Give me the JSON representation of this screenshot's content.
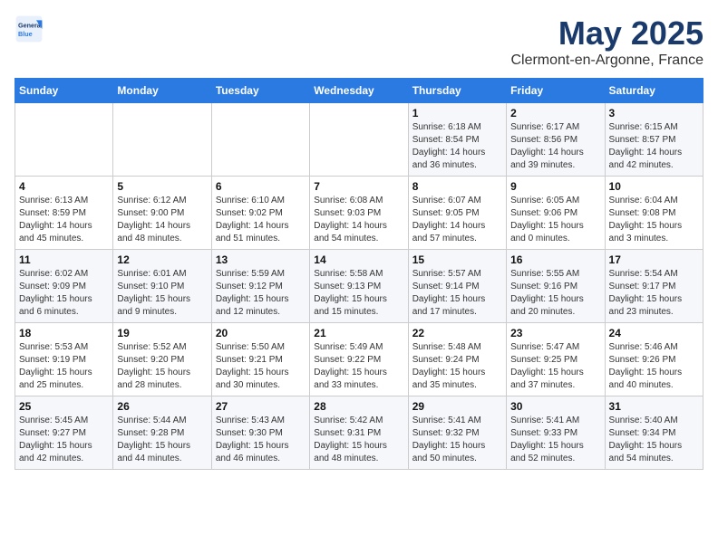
{
  "header": {
    "logo_text_general": "General",
    "logo_text_blue": "Blue",
    "title": "May 2025",
    "subtitle": "Clermont-en-Argonne, France"
  },
  "days_of_week": [
    "Sunday",
    "Monday",
    "Tuesday",
    "Wednesday",
    "Thursday",
    "Friday",
    "Saturday"
  ],
  "weeks": [
    [
      {
        "day": "",
        "info": ""
      },
      {
        "day": "",
        "info": ""
      },
      {
        "day": "",
        "info": ""
      },
      {
        "day": "",
        "info": ""
      },
      {
        "day": "1",
        "info": "Sunrise: 6:18 AM\nSunset: 8:54 PM\nDaylight: 14 hours\nand 36 minutes."
      },
      {
        "day": "2",
        "info": "Sunrise: 6:17 AM\nSunset: 8:56 PM\nDaylight: 14 hours\nand 39 minutes."
      },
      {
        "day": "3",
        "info": "Sunrise: 6:15 AM\nSunset: 8:57 PM\nDaylight: 14 hours\nand 42 minutes."
      }
    ],
    [
      {
        "day": "4",
        "info": "Sunrise: 6:13 AM\nSunset: 8:59 PM\nDaylight: 14 hours\nand 45 minutes."
      },
      {
        "day": "5",
        "info": "Sunrise: 6:12 AM\nSunset: 9:00 PM\nDaylight: 14 hours\nand 48 minutes."
      },
      {
        "day": "6",
        "info": "Sunrise: 6:10 AM\nSunset: 9:02 PM\nDaylight: 14 hours\nand 51 minutes."
      },
      {
        "day": "7",
        "info": "Sunrise: 6:08 AM\nSunset: 9:03 PM\nDaylight: 14 hours\nand 54 minutes."
      },
      {
        "day": "8",
        "info": "Sunrise: 6:07 AM\nSunset: 9:05 PM\nDaylight: 14 hours\nand 57 minutes."
      },
      {
        "day": "9",
        "info": "Sunrise: 6:05 AM\nSunset: 9:06 PM\nDaylight: 15 hours\nand 0 minutes."
      },
      {
        "day": "10",
        "info": "Sunrise: 6:04 AM\nSunset: 9:08 PM\nDaylight: 15 hours\nand 3 minutes."
      }
    ],
    [
      {
        "day": "11",
        "info": "Sunrise: 6:02 AM\nSunset: 9:09 PM\nDaylight: 15 hours\nand 6 minutes."
      },
      {
        "day": "12",
        "info": "Sunrise: 6:01 AM\nSunset: 9:10 PM\nDaylight: 15 hours\nand 9 minutes."
      },
      {
        "day": "13",
        "info": "Sunrise: 5:59 AM\nSunset: 9:12 PM\nDaylight: 15 hours\nand 12 minutes."
      },
      {
        "day": "14",
        "info": "Sunrise: 5:58 AM\nSunset: 9:13 PM\nDaylight: 15 hours\nand 15 minutes."
      },
      {
        "day": "15",
        "info": "Sunrise: 5:57 AM\nSunset: 9:14 PM\nDaylight: 15 hours\nand 17 minutes."
      },
      {
        "day": "16",
        "info": "Sunrise: 5:55 AM\nSunset: 9:16 PM\nDaylight: 15 hours\nand 20 minutes."
      },
      {
        "day": "17",
        "info": "Sunrise: 5:54 AM\nSunset: 9:17 PM\nDaylight: 15 hours\nand 23 minutes."
      }
    ],
    [
      {
        "day": "18",
        "info": "Sunrise: 5:53 AM\nSunset: 9:19 PM\nDaylight: 15 hours\nand 25 minutes."
      },
      {
        "day": "19",
        "info": "Sunrise: 5:52 AM\nSunset: 9:20 PM\nDaylight: 15 hours\nand 28 minutes."
      },
      {
        "day": "20",
        "info": "Sunrise: 5:50 AM\nSunset: 9:21 PM\nDaylight: 15 hours\nand 30 minutes."
      },
      {
        "day": "21",
        "info": "Sunrise: 5:49 AM\nSunset: 9:22 PM\nDaylight: 15 hours\nand 33 minutes."
      },
      {
        "day": "22",
        "info": "Sunrise: 5:48 AM\nSunset: 9:24 PM\nDaylight: 15 hours\nand 35 minutes."
      },
      {
        "day": "23",
        "info": "Sunrise: 5:47 AM\nSunset: 9:25 PM\nDaylight: 15 hours\nand 37 minutes."
      },
      {
        "day": "24",
        "info": "Sunrise: 5:46 AM\nSunset: 9:26 PM\nDaylight: 15 hours\nand 40 minutes."
      }
    ],
    [
      {
        "day": "25",
        "info": "Sunrise: 5:45 AM\nSunset: 9:27 PM\nDaylight: 15 hours\nand 42 minutes."
      },
      {
        "day": "26",
        "info": "Sunrise: 5:44 AM\nSunset: 9:28 PM\nDaylight: 15 hours\nand 44 minutes."
      },
      {
        "day": "27",
        "info": "Sunrise: 5:43 AM\nSunset: 9:30 PM\nDaylight: 15 hours\nand 46 minutes."
      },
      {
        "day": "28",
        "info": "Sunrise: 5:42 AM\nSunset: 9:31 PM\nDaylight: 15 hours\nand 48 minutes."
      },
      {
        "day": "29",
        "info": "Sunrise: 5:41 AM\nSunset: 9:32 PM\nDaylight: 15 hours\nand 50 minutes."
      },
      {
        "day": "30",
        "info": "Sunrise: 5:41 AM\nSunset: 9:33 PM\nDaylight: 15 hours\nand 52 minutes."
      },
      {
        "day": "31",
        "info": "Sunrise: 5:40 AM\nSunset: 9:34 PM\nDaylight: 15 hours\nand 54 minutes."
      }
    ]
  ]
}
